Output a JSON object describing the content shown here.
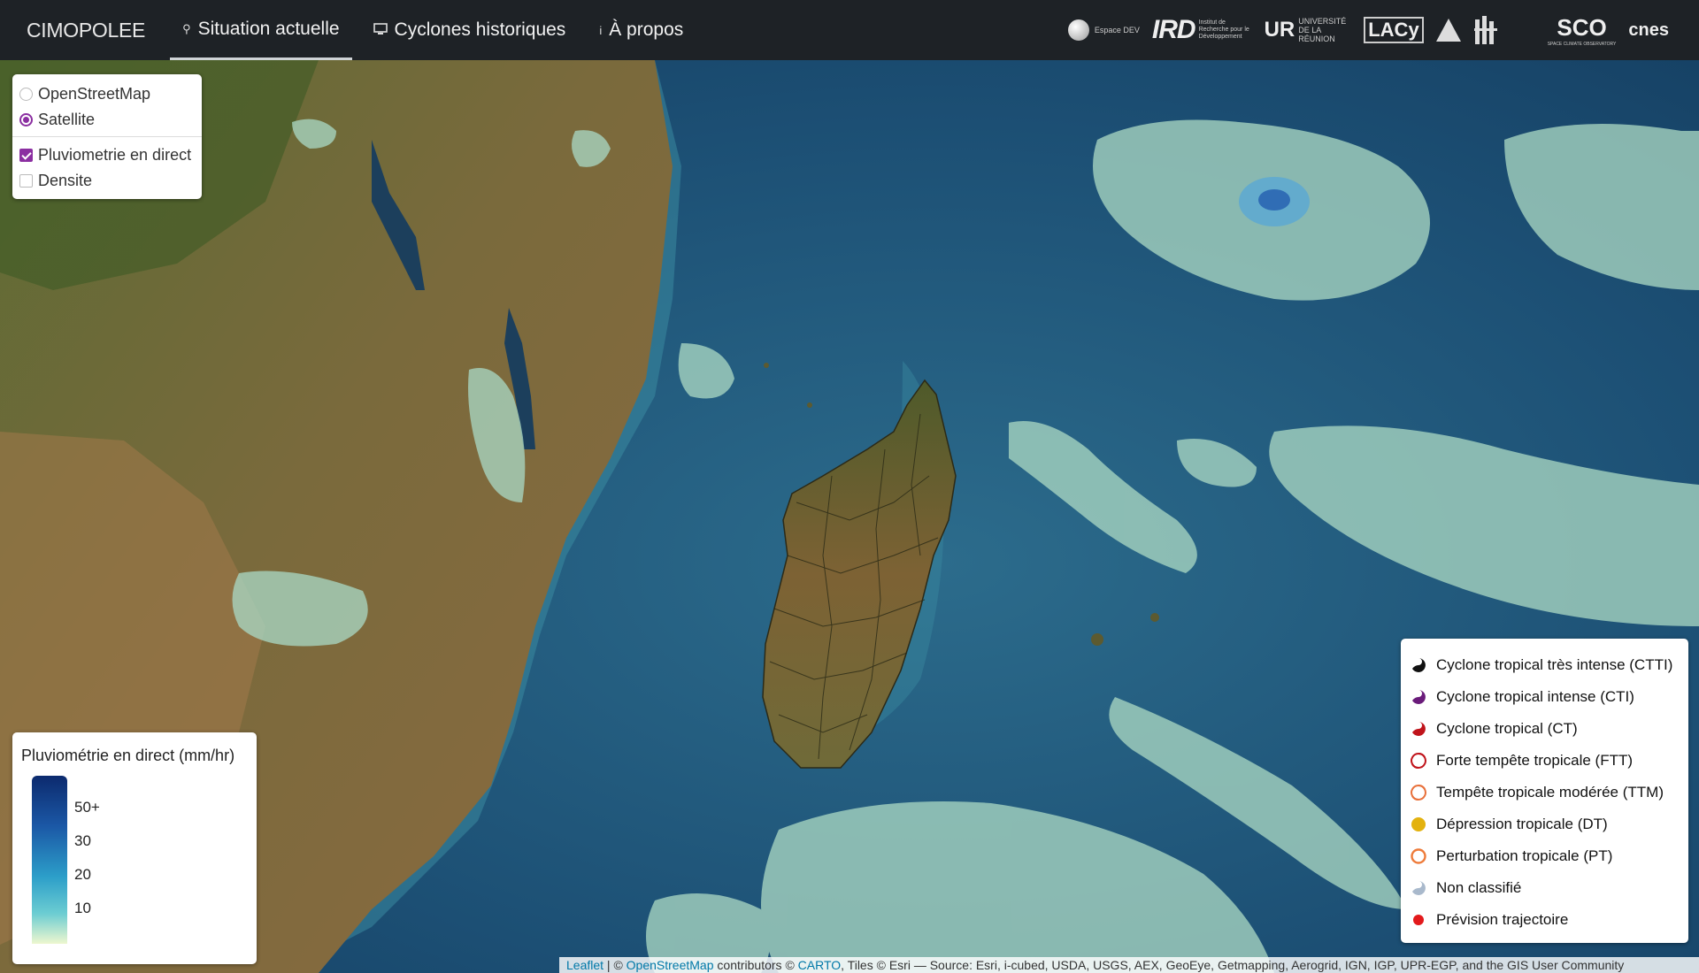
{
  "navbar": {
    "brand": "CIMOPOLEE",
    "items": [
      {
        "label": "Situation actuelle",
        "icon": "location-icon",
        "active": true
      },
      {
        "label": "Cyclones historiques",
        "icon": "monitor-icon",
        "active": false
      },
      {
        "label": "À propos",
        "icon": "info-icon",
        "active": false
      }
    ],
    "logos": {
      "ird": "IRD",
      "ird_caption": "Institut de Recherche pour le Développement",
      "ur": "UR",
      "ur_caption": "UNIVERSITÉ DE LA RÉUNION",
      "lacy": "LACy",
      "sco": "SCO",
      "sco_caption": "SPACE CLIMATE OBSERVATORY",
      "cnes": "cnes",
      "espace_dev": "Espace DEV"
    }
  },
  "layers": {
    "base": [
      {
        "label": "OpenStreetMap",
        "selected": false
      },
      {
        "label": "Satellite",
        "selected": true
      }
    ],
    "overlays": [
      {
        "label": "Pluviometrie en direct",
        "checked": true
      },
      {
        "label": "Densite",
        "checked": false
      }
    ]
  },
  "rain_legend": {
    "title": "Pluviométrie en direct (mm/hr)",
    "ticks": [
      "50+",
      "30",
      "20",
      "10"
    ]
  },
  "cyclone_legend": [
    {
      "label": "Cyclone tropical très intense (CTTI)",
      "color": "#111111",
      "style": "cyclone"
    },
    {
      "label": "Cyclone tropical intense (CTI)",
      "color": "#6a1b7a",
      "style": "cyclone"
    },
    {
      "label": "Cyclone tropical (CT)",
      "color": "#c0141b",
      "style": "cyclone"
    },
    {
      "label": "Forte tempête tropicale (FTT)",
      "color": "#c0141b",
      "style": "cyclone-outline"
    },
    {
      "label": "Tempête tropicale modérée (TTM)",
      "color": "#e8703a",
      "style": "cyclone-outline"
    },
    {
      "label": "Dépression tropicale (DT)",
      "color": "#e3b20f",
      "style": "dot"
    },
    {
      "label": "Perturbation tropicale (PT)",
      "color": "#ee7b3a",
      "style": "ring"
    },
    {
      "label": "Non classifié",
      "color": "#a9b9cc",
      "style": "cyclone"
    },
    {
      "label": "Prévision trajectoire",
      "color": "#e31a1c",
      "style": "small-dot"
    }
  ],
  "attribution": {
    "leaflet": "Leaflet",
    "sep1": " | © ",
    "osm": "OpenStreetMap",
    "mid": " contributors © ",
    "carto": "CARTO",
    "rest": ", Tiles © Esri — Source: Esri, i-cubed, USDA, USGS, AEX, GeoEye, Getmapping, Aerogrid, IGN, IGP, UPR-EGP, and the GIS User Community"
  }
}
